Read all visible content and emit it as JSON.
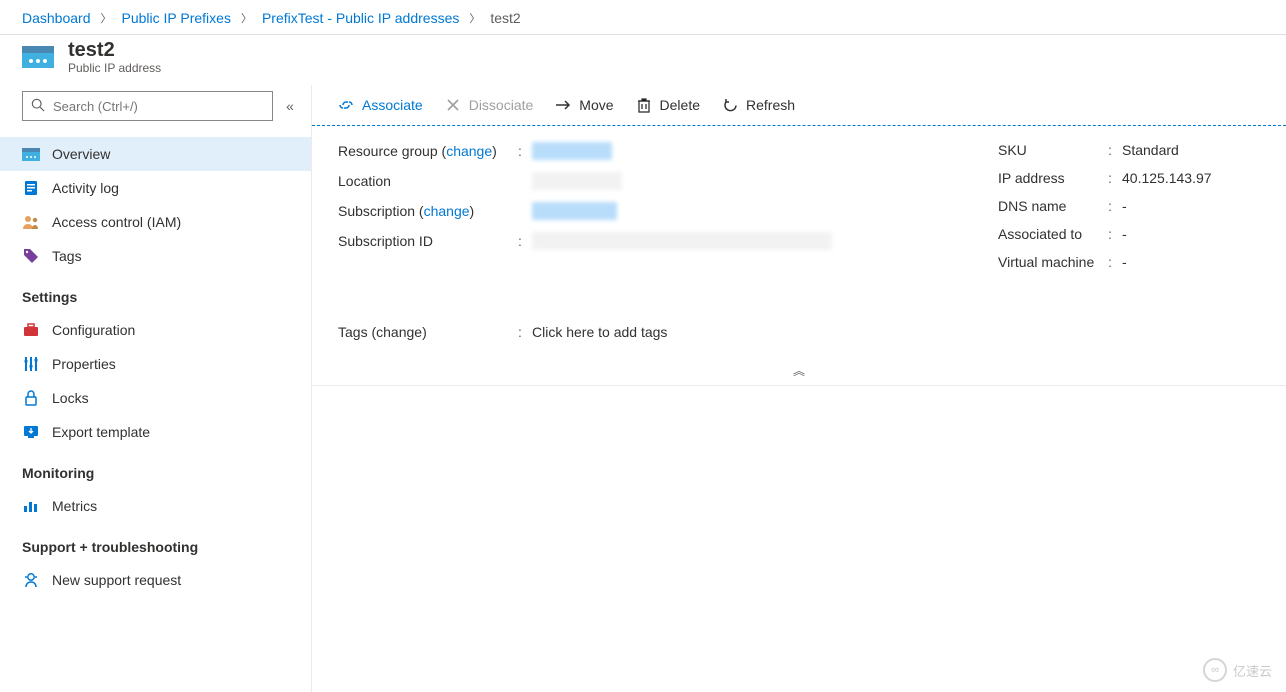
{
  "breadcrumb": [
    {
      "label": "Dashboard"
    },
    {
      "label": "Public IP Prefixes"
    },
    {
      "label": "PrefixTest - Public IP addresses"
    },
    {
      "label": "test2"
    }
  ],
  "header": {
    "title": "test2",
    "subtitle": "Public IP address"
  },
  "search": {
    "placeholder": "Search (Ctrl+/)"
  },
  "nav": {
    "top": [
      {
        "label": "Overview",
        "icon": "ip-card-icon",
        "active": true
      },
      {
        "label": "Activity log",
        "icon": "log-icon"
      },
      {
        "label": "Access control (IAM)",
        "icon": "people-icon"
      },
      {
        "label": "Tags",
        "icon": "tag-icon"
      }
    ],
    "groups": [
      {
        "title": "Settings",
        "items": [
          {
            "label": "Configuration",
            "icon": "toolbox-icon"
          },
          {
            "label": "Properties",
            "icon": "sliders-icon"
          },
          {
            "label": "Locks",
            "icon": "lock-icon"
          },
          {
            "label": "Export template",
            "icon": "export-icon"
          }
        ]
      },
      {
        "title": "Monitoring",
        "items": [
          {
            "label": "Metrics",
            "icon": "chart-icon"
          }
        ]
      },
      {
        "title": "Support + troubleshooting",
        "items": [
          {
            "label": "New support request",
            "icon": "support-icon"
          }
        ]
      }
    ]
  },
  "toolbar": {
    "associate": "Associate",
    "dissociate": "Dissociate",
    "move": "Move",
    "delete": "Delete",
    "refresh": "Refresh"
  },
  "essentials": {
    "left": {
      "resource_group_label": "Resource group",
      "change": "change",
      "location_label": "Location",
      "subscription_label": "Subscription",
      "subscription_id_label": "Subscription ID"
    },
    "right": {
      "sku_label": "SKU",
      "sku_value": "Standard",
      "ip_label": "IP address",
      "ip_value": "40.125.143.97",
      "dns_label": "DNS name",
      "dns_value": "-",
      "assoc_label": "Associated to",
      "assoc_value": "-",
      "vm_label": "Virtual machine",
      "vm_value": "-"
    }
  },
  "tags": {
    "label": "Tags",
    "change": "change",
    "add": "Click here to add tags"
  },
  "watermark": "亿速云"
}
